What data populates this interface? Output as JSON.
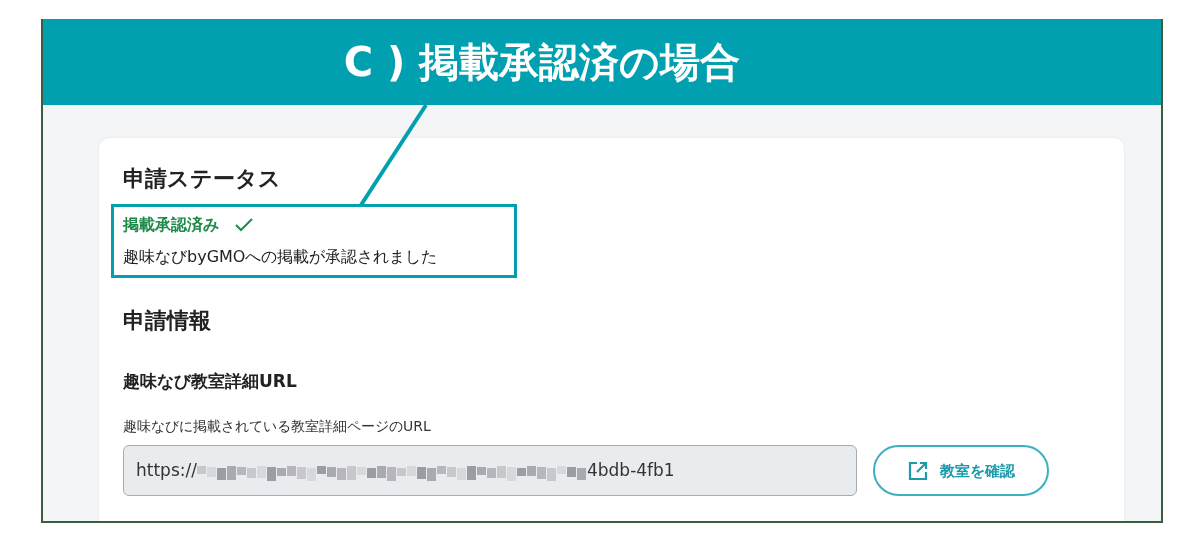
{
  "banner": {
    "title": "C ) 掲載承認済の場合"
  },
  "status_section": {
    "heading": "申請ステータス",
    "status": "掲載承認済み",
    "message": "趣味なびbyGMOへの掲載が承認されました"
  },
  "info_section": {
    "heading": "申請情報",
    "field_label": "趣味なび教室詳細URL",
    "field_hint": "趣味なびに掲載されている教室詳細ページのURL",
    "url_start": "https://",
    "url_end": "4bdb-4fb1",
    "button": "教室を確認"
  }
}
